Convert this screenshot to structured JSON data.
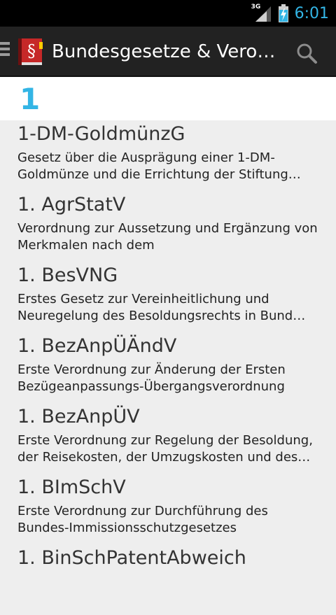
{
  "status_bar": {
    "network_type": "3G",
    "time": "6:01",
    "battery_icon": "battery-charging-icon",
    "signal_icon": "signal-icon",
    "time_color": "#33b5e5"
  },
  "action_bar": {
    "title": "Bundesgesetze & Verordnungen",
    "drawer_icon": "menu-icon",
    "app_icon": "law-book-icon",
    "search_icon": "search-icon"
  },
  "section": {
    "letter": "1",
    "accent_color": "#33b5e5"
  },
  "laws": [
    {
      "abbr": "1-DM-GoldmünzG",
      "desc": "Gesetz über die Ausprägung einer 1-DM-Goldmünze und die Errichtung der Stiftung „Geld und Währung“"
    },
    {
      "abbr": "1. AgrStatV",
      "desc": "Verordnung zur Aussetzung und Ergänzung von Merkmalen nach dem"
    },
    {
      "abbr": "1. BesVNG",
      "desc": "Erstes Gesetz zur Vereinheitlichung und Neuregelung des Besoldungsrechts in Bund und Ländern"
    },
    {
      "abbr": "1. BezAnpÜÄndV",
      "desc": "Erste Verordnung zur Änderung der Ersten Bezügeanpassungs-Übergangsverordnung"
    },
    {
      "abbr": "1. BezAnpÜV",
      "desc": "Erste Verordnung zur Regelung der Besoldung, der Reisekosten, der Umzugskosten und des Trennungsgeldes"
    },
    {
      "abbr": "1. BImSchV",
      "desc": "Erste Verordnung zur Durchführung des Bundes-Immissionsschutzgesetzes"
    },
    {
      "abbr": "1. BinSchPatentAbweich",
      "desc": ""
    }
  ]
}
